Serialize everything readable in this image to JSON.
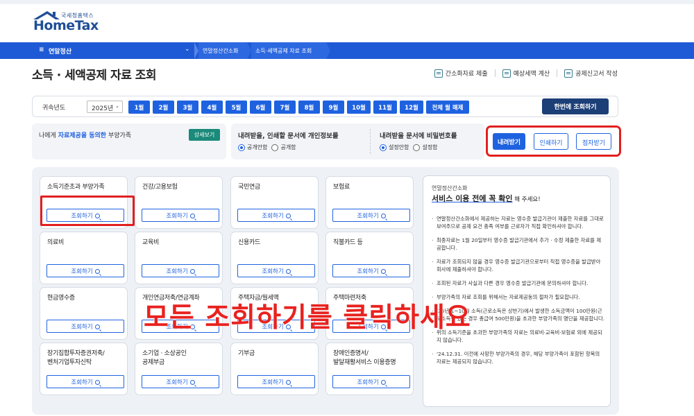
{
  "logo": {
    "korean": "국세청홈택스",
    "english": "HomeTax"
  },
  "nav": {
    "menu_label": "연말정산",
    "breadcrumbs": [
      "연말정산간소화",
      "소득·세액공제 자료 조회"
    ]
  },
  "page": {
    "title": "소득 · 세액공제 자료 조회"
  },
  "toplinks": [
    "간소화자료 제출",
    "예상세액 계산",
    "공제신고서 작성"
  ],
  "yearbar": {
    "label": "귀속년도",
    "year": "2025년",
    "months": [
      "1월",
      "2월",
      "3월",
      "4월",
      "5월",
      "6월",
      "7월",
      "8월",
      "9월",
      "10월",
      "11월",
      "12월",
      "전체 월 해제"
    ],
    "all_button": "한번에 조회하기"
  },
  "consent": {
    "prefix": "나에게 ",
    "highlight": "자료제공을 동의한",
    "suffix": " 부양가족",
    "detail_button": "상세보기"
  },
  "privacy": {
    "question": "내려받을, 인쇄할 문서에 개인정보를",
    "option_on": "공개안함",
    "option_off": "공개함"
  },
  "password": {
    "question": "내려받을 문서에 비밀번호를",
    "option_on": "설정안함",
    "option_off": "설정함"
  },
  "actions": {
    "download": "내려받기",
    "print": "인쇄하기",
    "braille": "점자받기"
  },
  "query_label": "조회하기",
  "categories": [
    [
      "소득기준초과 부양가족"
    ],
    [
      "건강/고용보험"
    ],
    [
      "국민연금"
    ],
    [
      "보험료"
    ],
    [
      "의료비"
    ],
    [
      "교육비"
    ],
    [
      "신용카드"
    ],
    [
      "직불카드 등"
    ],
    [
      "현금영수증"
    ],
    [
      "개인연금저축/연금계좌"
    ],
    [
      "주택자금/월세액"
    ],
    [
      "주택마련저축"
    ],
    [
      "장기집합투자증권저축/",
      "벤처기업투자신탁"
    ],
    [
      "소기업 · 소상공인",
      "공제부금"
    ],
    [
      "기부금"
    ],
    [
      "장애인증명서/",
      "발달재활서비스 이용증명"
    ]
  ],
  "info": {
    "subtitle": "연말정산간소화",
    "heading": "서비스 이용 전에 꼭 확인",
    "heading_tail": " 해 주세요!",
    "items": [
      "연말정산간소화에서 제공하는 자료는 영수증 발급기관이 제출한 자료를 그대로 보여주므로 공제 요건 충족 여부를 근로자가 직접 확인하셔야 합니다.",
      "최종자료는 1월 20일부터 영수증 발급기관에서 추가 · 수정 제출한 자료를 제공합니다.",
      "자료가 조회되지 않을 경우 영수증 발급기관으로부터 직접 영수증을 발급받아 회사에 제출하셔야 합니다.",
      "조회된 자료가 사실과 다른 경우 영수증 발급기관에 문의하셔야 합니다.",
      "부양가족의 자료 조회를 위해서는 자료제공동의 절차가 필요합니다.",
      "'25년 1~10월 소득(근로소득은 상반기)에서 발생한 소득금액이 100만원(근로소득만 있는 경우 총급여 500만원)을 초과한 부양가족의 명단을 제공합니다.",
      "위의 소득기준을 초과한 부양가족의 자료는 의료비·교육비·보험료 외에 제공되지 않습니다.",
      "'24.12.31. 이전에 사망한 부양가족의 경우, 해당 부양가족이 포함된 항목의 자료는 제공되지 않습니다."
    ]
  },
  "overlay_text": "모든 조회하기를 클릭하세요"
}
